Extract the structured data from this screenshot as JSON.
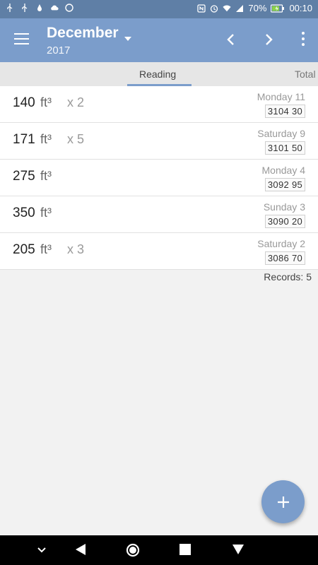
{
  "status_bar": {
    "battery": "70%",
    "time": "00:10",
    "icons": [
      "usb-icon",
      "usb-icon",
      "water-drop-icon",
      "cloud-icon",
      "circle-icon",
      "nfc-icon",
      "alarm-icon",
      "wifi-icon",
      "signal-icon",
      "battery-charging-icon"
    ]
  },
  "toolbar": {
    "month": "December",
    "year": "2017",
    "menu_icon": "hamburger-icon",
    "prev_icon": "chevron-left-icon",
    "next_icon": "chevron-right-icon",
    "more_icon": "more-vert-icon"
  },
  "tabs": [
    {
      "label": "Reading",
      "selected": true
    },
    {
      "label": "Total",
      "selected": false
    }
  ],
  "records": [
    {
      "amount": "140",
      "unit": "ft³",
      "multiplier": "x 2",
      "date": "Monday 11",
      "meter": "3104 30"
    },
    {
      "amount": "171",
      "unit": "ft³",
      "multiplier": "x 5",
      "date": "Saturday 9",
      "meter": "3101 50"
    },
    {
      "amount": "275",
      "unit": "ft³",
      "multiplier": "",
      "date": "Monday 4",
      "meter": "3092 95"
    },
    {
      "amount": "350",
      "unit": "ft³",
      "multiplier": "",
      "date": "Sunday 3",
      "meter": "3090 20"
    },
    {
      "amount": "205",
      "unit": "ft³",
      "multiplier": "x 3",
      "date": "Saturday 2",
      "meter": "3086 70"
    }
  ],
  "records_count": "Records: 5",
  "fab": {
    "icon": "plus-icon"
  },
  "nav_bar": {
    "icons": [
      "chevron-down-icon",
      "back-icon",
      "home-icon",
      "recents-icon",
      "notifications-icon"
    ]
  },
  "colors": {
    "primary": "#7b9dcb",
    "status_bar": "#5f7fa6"
  }
}
